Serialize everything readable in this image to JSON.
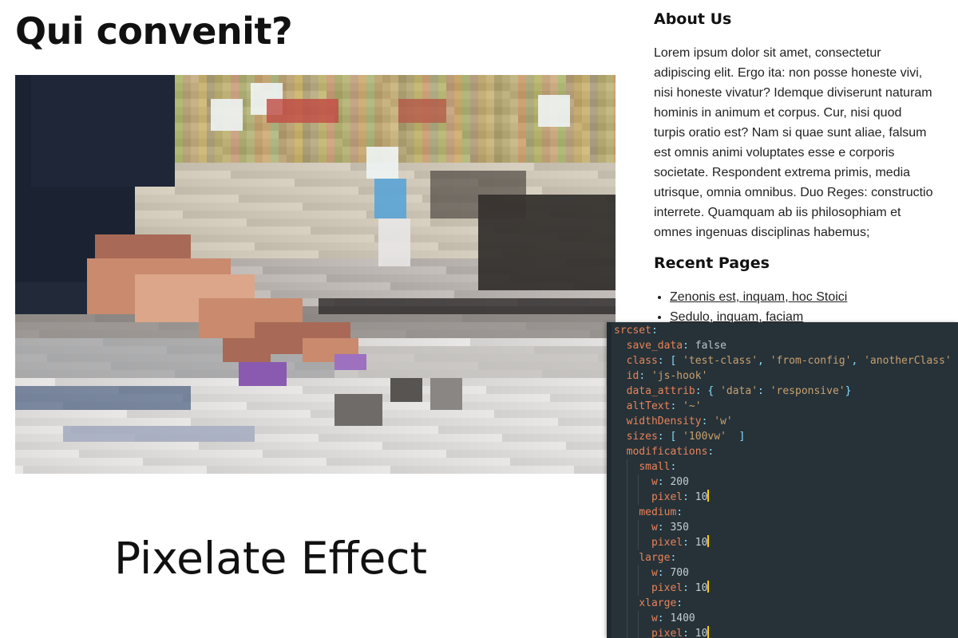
{
  "page": {
    "title": "Qui convenit?"
  },
  "hero": {
    "alt": "Pixelated photo of a hand on a mixing console"
  },
  "caption": "Pixelate Effect",
  "sidebar": {
    "about": {
      "title": "About Us",
      "text": "Lorem ipsum dolor sit amet, consectetur adipiscing elit. Ergo ita: non posse honeste vivi, nisi honeste vivatur? Idemque diviserunt naturam hominis in animum et corpus. Cur, nisi quod turpis oratio est? Nam si quae sunt aliae, falsum est omnis animi voluptates esse e corporis societate. Respondent extrema primis, media utrisque, omnia omnibus. Duo Reges: constructio interrete. Quamquam ab iis philosophiam et omnes ingenuas disciplinas habemus;"
    },
    "recent": {
      "title": "Recent Pages",
      "items": [
        {
          "label": "Zenonis est, inquam, hoc Stoici"
        },
        {
          "label": "Sedulo, inquam, faciam"
        }
      ]
    }
  },
  "code": {
    "lines": [
      {
        "indent": 0,
        "parts": [
          [
            "k",
            "srcset"
          ],
          [
            "p",
            ":"
          ]
        ]
      },
      {
        "indent": 1,
        "parts": [
          [
            "k",
            "save_data"
          ],
          [
            "p",
            ": "
          ],
          [
            "b",
            "false"
          ]
        ]
      },
      {
        "indent": 1,
        "parts": [
          [
            "k",
            "class"
          ],
          [
            "p",
            ": [ "
          ],
          [
            "s",
            "'test-class'"
          ],
          [
            "p",
            ", "
          ],
          [
            "s",
            "'from-config'"
          ],
          [
            "p",
            ", "
          ],
          [
            "s",
            "'anotherClass'"
          ],
          [
            "p",
            " ]"
          ]
        ]
      },
      {
        "indent": 1,
        "parts": [
          [
            "k",
            "id"
          ],
          [
            "p",
            ": "
          ],
          [
            "s",
            "'js-hook'"
          ]
        ]
      },
      {
        "indent": 1,
        "parts": [
          [
            "k",
            "data_attrib"
          ],
          [
            "p",
            ": { "
          ],
          [
            "s",
            "'data'"
          ],
          [
            "p",
            ": "
          ],
          [
            "s",
            "'responsive'"
          ],
          [
            "p",
            "}"
          ]
        ]
      },
      {
        "indent": 1,
        "parts": [
          [
            "k",
            "altText"
          ],
          [
            "p",
            ": "
          ],
          [
            "s",
            "'~'"
          ]
        ]
      },
      {
        "indent": 1,
        "parts": [
          [
            "k",
            "widthDensity"
          ],
          [
            "p",
            ": "
          ],
          [
            "s",
            "'w'"
          ]
        ]
      },
      {
        "indent": 1,
        "parts": [
          [
            "k",
            "sizes"
          ],
          [
            "p",
            ": [ "
          ],
          [
            "s",
            "'100vw'"
          ],
          [
            "p",
            "  ]"
          ]
        ]
      },
      {
        "indent": 1,
        "parts": [
          [
            "k",
            "modifications"
          ],
          [
            "p",
            ":"
          ]
        ]
      },
      {
        "indent": 2,
        "parts": [
          [
            "k",
            "small"
          ],
          [
            "p",
            ":"
          ]
        ]
      },
      {
        "indent": 3,
        "parts": [
          [
            "k",
            "w"
          ],
          [
            "p",
            ": "
          ],
          [
            "n",
            "200"
          ]
        ]
      },
      {
        "indent": 3,
        "parts": [
          [
            "k",
            "pixel"
          ],
          [
            "p",
            ": "
          ],
          [
            "n",
            "10"
          ]
        ],
        "cursor": true
      },
      {
        "indent": 2,
        "parts": [
          [
            "k",
            "medium"
          ],
          [
            "p",
            ":"
          ]
        ]
      },
      {
        "indent": 3,
        "parts": [
          [
            "k",
            "w"
          ],
          [
            "p",
            ": "
          ],
          [
            "n",
            "350"
          ]
        ]
      },
      {
        "indent": 3,
        "parts": [
          [
            "k",
            "pixel"
          ],
          [
            "p",
            ": "
          ],
          [
            "n",
            "10"
          ]
        ],
        "cursor": true
      },
      {
        "indent": 2,
        "parts": [
          [
            "k",
            "large"
          ],
          [
            "p",
            ":"
          ]
        ]
      },
      {
        "indent": 3,
        "parts": [
          [
            "k",
            "w"
          ],
          [
            "p",
            ": "
          ],
          [
            "n",
            "700"
          ]
        ]
      },
      {
        "indent": 3,
        "parts": [
          [
            "k",
            "pixel"
          ],
          [
            "p",
            ": "
          ],
          [
            "n",
            "10"
          ]
        ],
        "cursor": true
      },
      {
        "indent": 2,
        "parts": [
          [
            "k",
            "xlarge"
          ],
          [
            "p",
            ":"
          ]
        ]
      },
      {
        "indent": 3,
        "parts": [
          [
            "k",
            "w"
          ],
          [
            "p",
            ": "
          ],
          [
            "n",
            "1400"
          ]
        ]
      },
      {
        "indent": 3,
        "parts": [
          [
            "k",
            "pixel"
          ],
          [
            "p",
            ": "
          ],
          [
            "n",
            "10"
          ]
        ],
        "cursor": true
      }
    ]
  },
  "colors": {
    "code_background": "#263238",
    "code_key": "#e8835a",
    "code_string": "#c9a070",
    "code_cursor": "#ffcc00"
  }
}
